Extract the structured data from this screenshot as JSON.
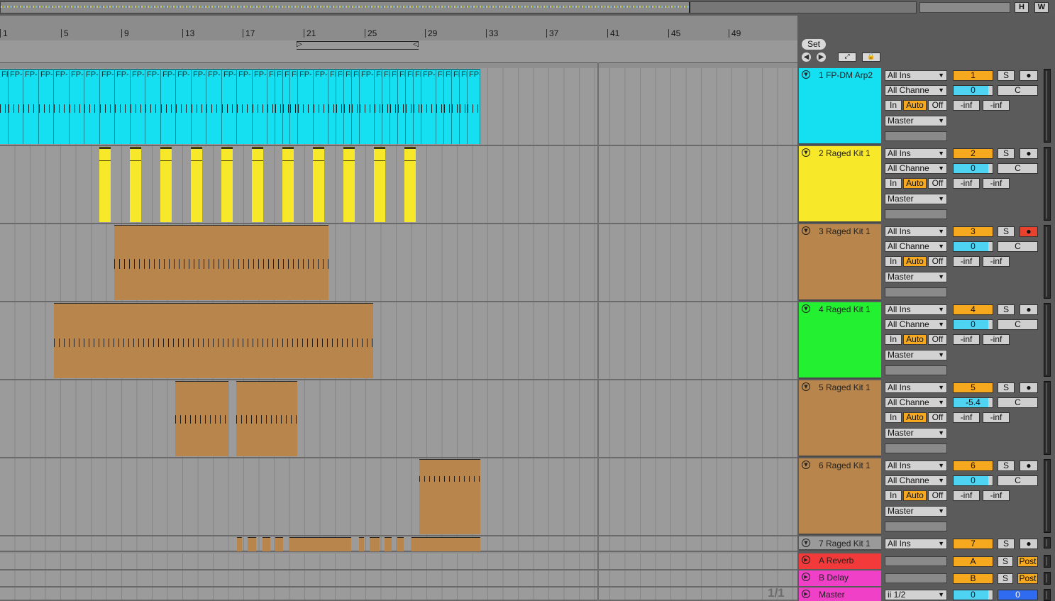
{
  "topbar": {
    "h_label": "H",
    "w_label": "W"
  },
  "ruler": {
    "bars": [
      "1",
      "5",
      "9",
      "13",
      "17",
      "21",
      "25",
      "29",
      "33",
      "37",
      "41",
      "45",
      "49"
    ]
  },
  "session": {
    "set_label": "Set",
    "page_indicator": "1/1"
  },
  "tracks": [
    {
      "id": "1",
      "name": "1 FP-DM Arp2",
      "color": "#14e0f2",
      "input": "All Ins",
      "channel": "All Channe",
      "monitor": [
        "In",
        "Auto",
        "Off"
      ],
      "output": "Master",
      "number": "1",
      "volume": "0",
      "solo": "S",
      "pan": "C",
      "sends": [
        "-inf",
        "-inf"
      ],
      "armed": false,
      "clip_label": "FP-"
    },
    {
      "id": "2",
      "name": "2 Raged Kit 1",
      "color": "#f8e82a",
      "input": "All Ins",
      "channel": "All Channe",
      "monitor": [
        "In",
        "Auto",
        "Off"
      ],
      "output": "Master",
      "number": "2",
      "volume": "0",
      "solo": "S",
      "pan": "C",
      "sends": [
        "-inf",
        "-inf"
      ],
      "armed": false
    },
    {
      "id": "3",
      "name": "3 Raged Kit 1",
      "color": "#b8864c",
      "input": "All Ins",
      "channel": "All Channe",
      "monitor": [
        "In",
        "Auto",
        "Off"
      ],
      "output": "Master",
      "number": "3",
      "volume": "0",
      "solo": "S",
      "pan": "C",
      "sends": [
        "-inf",
        "-inf"
      ],
      "armed": true
    },
    {
      "id": "4",
      "name": "4 Raged Kit 1",
      "color": "#22f030",
      "input": "All Ins",
      "channel": "All Channe",
      "monitor": [
        "In",
        "Auto",
        "Off"
      ],
      "output": "Master",
      "number": "4",
      "volume": "0",
      "solo": "S",
      "pan": "C",
      "sends": [
        "-inf",
        "-inf"
      ],
      "armed": false
    },
    {
      "id": "5",
      "name": "5 Raged Kit 1",
      "color": "#b8864c",
      "input": "All Ins",
      "channel": "All Channe",
      "monitor": [
        "In",
        "Auto",
        "Off"
      ],
      "output": "Master",
      "number": "5",
      "volume": "-5.4",
      "solo": "S",
      "pan": "C",
      "sends": [
        "-inf",
        "-inf"
      ],
      "armed": false
    },
    {
      "id": "6",
      "name": "6 Raged Kit 1",
      "color": "#b8864c",
      "input": "All Ins",
      "channel": "All Channe",
      "monitor": [
        "In",
        "Auto",
        "Off"
      ],
      "output": "Master",
      "number": "6",
      "volume": "0",
      "solo": "S",
      "pan": "C",
      "sends": [
        "-inf",
        "-inf"
      ],
      "armed": false
    },
    {
      "id": "7",
      "name": "7 Raged Kit 1",
      "color": "#b8864c",
      "input": "All Ins",
      "number": "7",
      "solo": "S",
      "armed": false
    }
  ],
  "returns": [
    {
      "name": "A Reverb",
      "color": "#f23a3a",
      "letter": "A",
      "solo": "S",
      "post": "Post"
    },
    {
      "name": "B Delay",
      "color": "#f040c8",
      "letter": "B",
      "solo": "S",
      "post": "Post"
    }
  ],
  "master": {
    "name": "Master",
    "color": "#f040c8",
    "input": "1/2",
    "volume": "0",
    "cue": "0"
  }
}
